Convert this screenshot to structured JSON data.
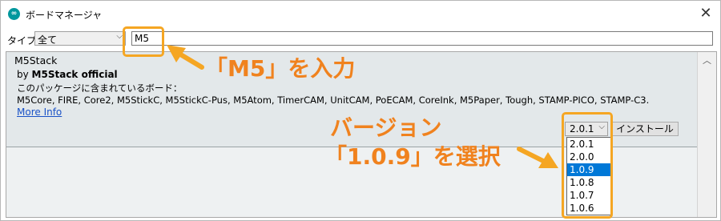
{
  "window": {
    "title": "ボードマネージャ",
    "app_icon": "arduino-icon",
    "close_glyph": "✕"
  },
  "toolbar": {
    "type_label": "タイプ",
    "type_value": "全て",
    "type_chevron": "⌵",
    "search_value": "M5"
  },
  "package": {
    "name": "M5Stack",
    "by_prefix": "by ",
    "author": "M5Stack official",
    "description": "このパッケージに含まれているボード：",
    "boards": "M5Core, FIRE, Core2, M5StickC, M5StickC-Pus, M5Atom, TimerCAM, UnitCAM, PoECAM, CoreInk, M5Paper, Tough, STAMP-PICO, STAMP-C3.",
    "more_info": "More Info",
    "version_selected": "2.0.1",
    "version_chevron": "⌵",
    "install_label": "インストール",
    "version_options": [
      "2.0.1",
      "2.0.0",
      "1.0.9",
      "1.0.8",
      "1.0.7",
      "1.0.6"
    ],
    "highlighted_option": "1.0.9"
  },
  "scrollbar": {
    "up_glyph": "︿"
  },
  "annotations": {
    "search_note": "「M5」を入力",
    "version_note_line1": "バージョン",
    "version_note_line2": "「1.0.9」を選択",
    "color": "#f0821e",
    "box_color": "#f5a623"
  },
  "colors": {
    "selection": "#0078d7",
    "link": "#1a52c7",
    "list_bg": "#e3e8ea"
  }
}
